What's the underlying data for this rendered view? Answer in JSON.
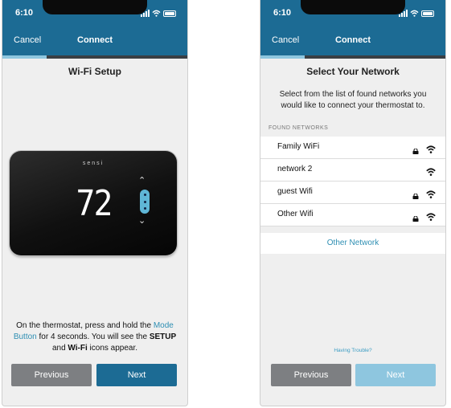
{
  "status_time": "6:10",
  "screens": [
    {
      "nav": {
        "cancel": "Cancel",
        "title": "Connect"
      },
      "progress": 0.24,
      "title": "Wi-Fi Setup",
      "thermostat": {
        "brand": "sensi",
        "temperature": "72"
      },
      "instructions": {
        "t1": "On the thermostat, press and hold the ",
        "mode": "Mode",
        "button": "Button",
        "t2": " for 4 seconds. You will see the ",
        "setup": "SETUP",
        "t3": "and ",
        "wifi": "Wi-Fi",
        "t4": " icons appear."
      },
      "buttons": {
        "previous": "Previous",
        "next": "Next"
      }
    },
    {
      "nav": {
        "cancel": "Cancel",
        "title": "Connect"
      },
      "progress": 0.24,
      "title": "Select Your Network",
      "subtitle": "Select from the list of found networks you would like to connect your thermostat to.",
      "section_header": "FOUND NETWORKS",
      "networks": [
        {
          "name": "Family WiFi",
          "locked": true
        },
        {
          "name": "network 2",
          "locked": false
        },
        {
          "name": "guest Wifi",
          "locked": true
        },
        {
          "name": "Other Wifi",
          "locked": true
        }
      ],
      "other_network": "Other Network",
      "help": "Having Trouble?",
      "buttons": {
        "previous": "Previous",
        "next": "Next"
      }
    }
  ],
  "colors": {
    "brand_blue": "#1c6b94",
    "accent": "#2f8fb3",
    "disabled_next": "#8ec6df"
  }
}
